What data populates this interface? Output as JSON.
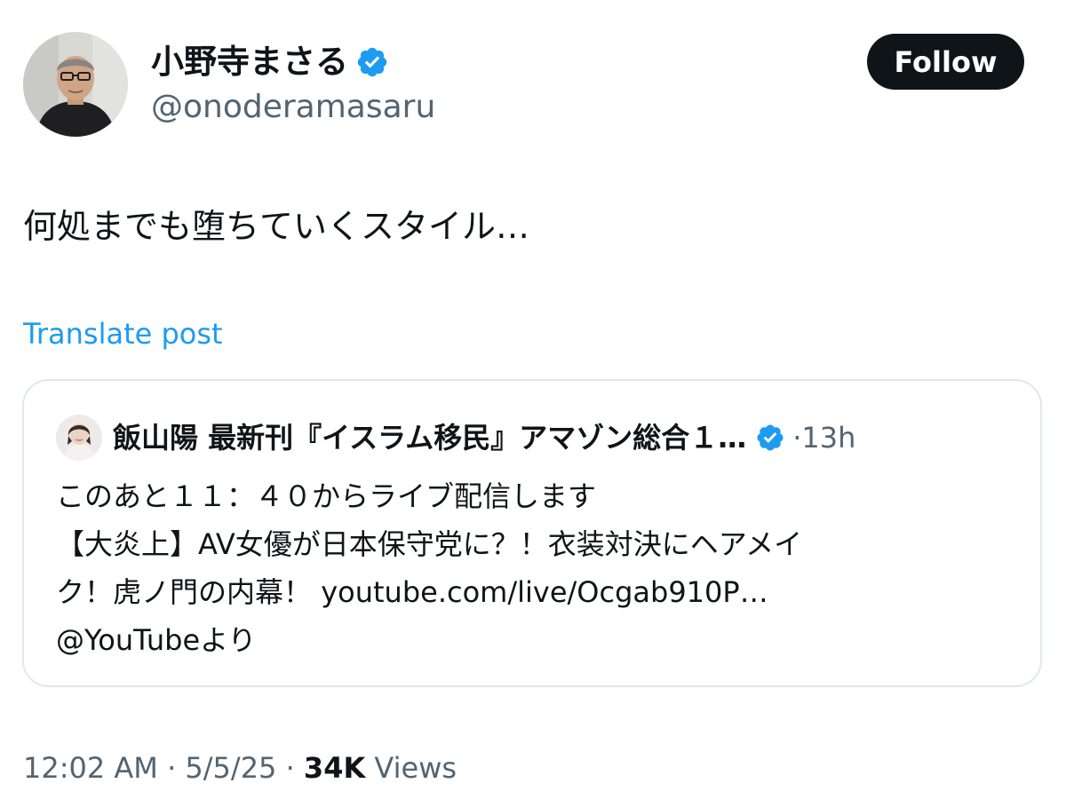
{
  "author": {
    "display_name": "小野寺まさる",
    "handle": "@onoderamasaru",
    "verified_icon": "verified-badge-icon"
  },
  "follow_button": {
    "label": "Follow"
  },
  "post": {
    "text": "何処までも堕ちていくスタイル…",
    "translate_label": "Translate post"
  },
  "quoted_post": {
    "author_name": "飯山陽 最新刊『イスラム移民』アマゾン総合１…",
    "verified_icon": "verified-badge-icon",
    "separator": "·",
    "time_ago": "13h",
    "lines": [
      "このあと１１：４０からライブ配信します",
      "【大炎上】AV女優が日本保守党に？！衣装対決にヘアメイ",
      "ク！虎ノ門の内幕！"
    ],
    "link_text": "youtube.com/live/Ocgab910P…",
    "mention": "@YouTube",
    "mention_suffix": "より"
  },
  "footer": {
    "time": "12:02 AM",
    "separator": "·",
    "date": "5/5/25",
    "views_count": "34K",
    "views_label": "Views"
  },
  "colors": {
    "text": "#0f1419",
    "secondary": "#536471",
    "link": "#1d9bf0",
    "verified": "#1d9bf0",
    "border": "#e1e8ed",
    "button_bg": "#0f1419"
  }
}
